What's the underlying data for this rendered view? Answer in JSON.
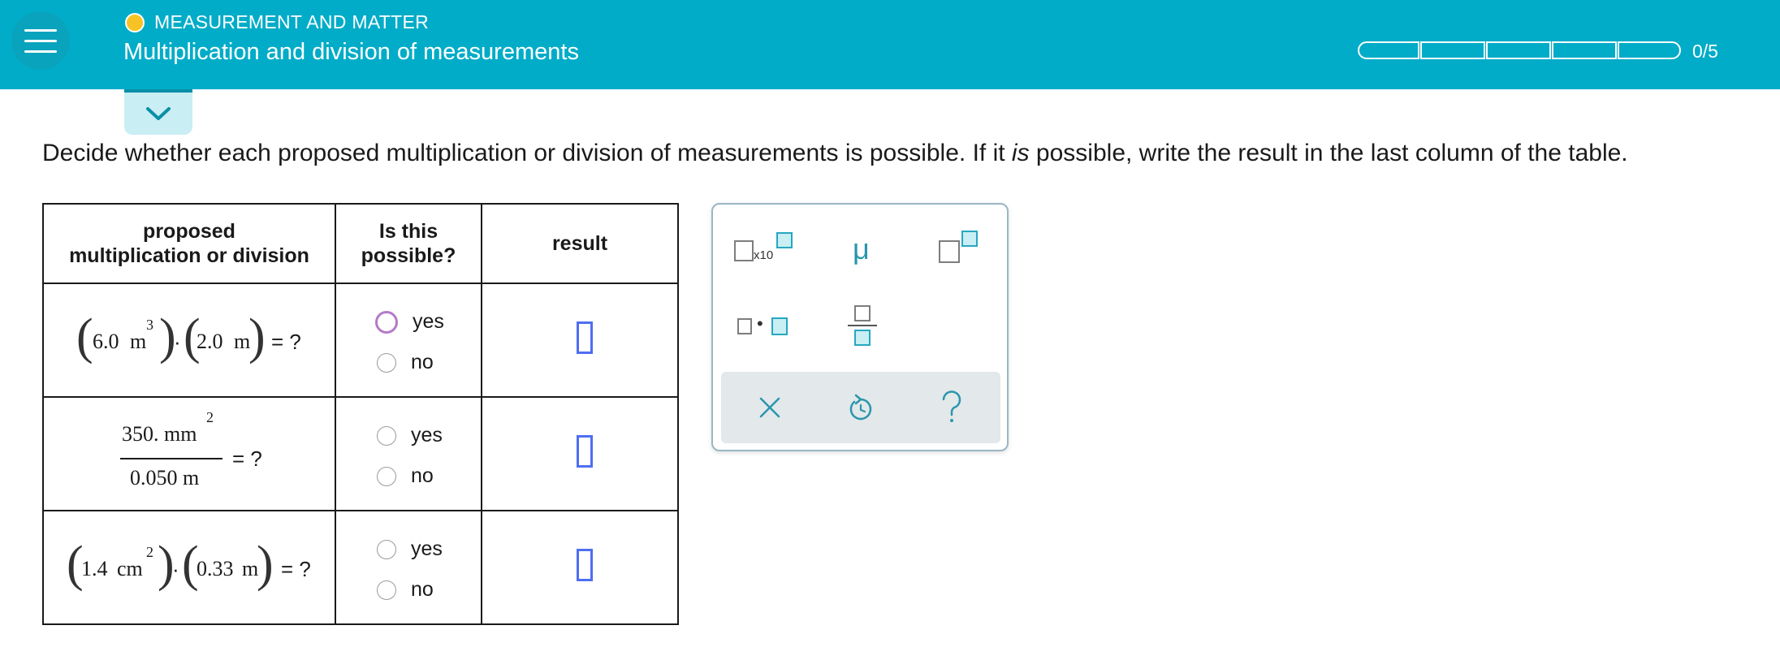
{
  "header": {
    "topic": "MEASUREMENT AND MATTER",
    "lesson_title": "Multiplication and division of measurements",
    "progress_label": "0/5",
    "progress_segments": 5,
    "progress_filled": 0,
    "colors": {
      "bar": "#00acc8",
      "topic_dot": "#f7c324"
    }
  },
  "instructions": {
    "before_em": "Decide whether each proposed multiplication or division of measurements is possible. If it ",
    "em": "is",
    "after_em": " possible, write the result in the last column of the table."
  },
  "table": {
    "headers": {
      "col1_line1": "proposed",
      "col1_line2": "multiplication or division",
      "col2_line1": "Is this",
      "col2_line2": "possible?",
      "col3": "result"
    },
    "rows": [
      {
        "expr": {
          "a_val": "6.0",
          "a_unit": "m",
          "a_exp": "3",
          "dot": "·",
          "b_val": "2.0",
          "b_unit": "m",
          "eq": "= ?"
        },
        "yes": "yes",
        "no": "no"
      },
      {
        "expr": {
          "num": "350.  mm",
          "num_exp": "2",
          "den": "0.050  m",
          "eq": "= ?"
        },
        "yes": "yes",
        "no": "no"
      },
      {
        "expr": {
          "a_val": "1.4",
          "a_unit": "cm",
          "a_exp": "2",
          "dot": "·",
          "b_val": "0.33",
          "b_unit": "m",
          "eq": "= ?"
        },
        "yes": "yes",
        "no": "no"
      }
    ]
  },
  "palette": {
    "x10_label": "x10",
    "mu_label": "μ",
    "dot_label": "•",
    "icons": [
      "times-ten-icon",
      "micro-icon",
      "superscript-icon",
      "multiply-dot-icon",
      "fraction-icon",
      "clear-icon",
      "undo-icon",
      "help-icon"
    ],
    "colors": {
      "teal": "#26a7c0",
      "footer": "#e3e8ea"
    }
  }
}
